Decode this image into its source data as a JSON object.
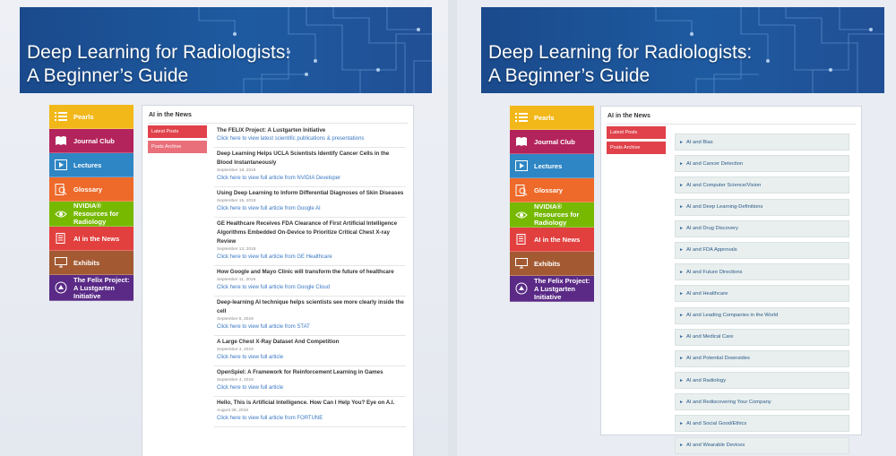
{
  "left": {
    "banner": {
      "title_line1": "Deep Learning for Radiologists:",
      "title_line2": "A Beginner’s Guide"
    },
    "nav": [
      {
        "label": "Pearls",
        "color": "#f2b81a",
        "icon": "list-icon"
      },
      {
        "label": "Journal Club",
        "color": "#b3245c",
        "icon": "book-icon"
      },
      {
        "label": "Lectures",
        "color": "#2f86c4",
        "icon": "play-icon"
      },
      {
        "label": "Glossary",
        "color": "#ee6a2a",
        "icon": "magnifier-doc-icon"
      },
      {
        "label": "NVIDIA® Resources for Radiology",
        "color": "#76b900",
        "icon": "nvidia-eye-icon"
      },
      {
        "label": "AI in the News",
        "color": "#e2403f",
        "icon": "newspaper-icon"
      },
      {
        "label": "Exhibits",
        "color": "#a35a33",
        "icon": "monitor-icon"
      },
      {
        "label": "The Felix Project: A Lustgarten Initiative",
        "color": "#5a2a86",
        "icon": "felix-logo-icon"
      }
    ],
    "section_title": "AI in the News",
    "tabs": [
      "Latest Posts",
      "Posts Archive"
    ],
    "articles": [
      {
        "title": "The FELIX Project: A Lustgarten Initiative",
        "date": "",
        "link": "Click here to view latest scientific publications & presentations"
      },
      {
        "title": "Deep Learning Helps UCLA Scientists Identify Cancer Cells in the Blood Instantaneously",
        "date": "September 18, 2019",
        "link": "Click here to view full article from NVIDIA Developer"
      },
      {
        "title": "Using Deep Learning to Inform Differential Diagnoses of Skin Diseases",
        "date": "September 15, 2019",
        "link": "Click here to view full article from Google AI"
      },
      {
        "title": "GE Healthcare Receives FDA Clearance of First Artificial Intelligence Algorithms Embedded On-Device to Prioritize Critical Chest X-ray Review",
        "date": "September 13, 2019",
        "link": "Click here to view full article from GE Healthcare"
      },
      {
        "title": "How Google and Mayo Clinic will transform the future of healthcare",
        "date": "September 11, 2019",
        "link": "Click here to view full article from Google Cloud"
      },
      {
        "title": "Deep-learning AI technique helps scientists see more clearly inside the cell",
        "date": "September 5, 2019",
        "link": "Click here to view full article from STAT"
      },
      {
        "title": "A Large Chest X-Ray Dataset And Competition",
        "date": "September 4, 2019",
        "link": "Click here to view full article"
      },
      {
        "title": "OpenSpiel: A Framework for Reinforcement Learning in Games",
        "date": "September 4, 2019",
        "link": "Click here to view full article"
      },
      {
        "title": "Hello, This is Artificial Intelligence. How Can I Help You? Eye on A.I.",
        "date": "August 28, 2019",
        "link": "Click here to view full article from FORTUNE"
      }
    ]
  },
  "right": {
    "banner": {
      "title_line1": "Deep Learning for Radiologists:",
      "title_line2": "A Beginner’s Guide"
    },
    "section_title": "AI in the News",
    "tabs": [
      "Latest Posts",
      "Posts Archive"
    ],
    "topics": [
      "AI and Bias",
      "AI and Cancer Detection",
      "AI and Computer Science/Vision",
      "AI and Deep Learning-Definitions",
      "AI and Drug Discovery",
      "AI and FDA Approvals",
      "AI and Future Directions",
      "AI and Healthcare",
      "AI and Leading Companies in the World",
      "AI and Medical Care",
      "AI and Potential Downsides",
      "AI and Radiology",
      "AI and Rediscovering Your Company",
      "AI and Social Good/Ethics",
      "AI and Wearable Devices"
    ]
  }
}
